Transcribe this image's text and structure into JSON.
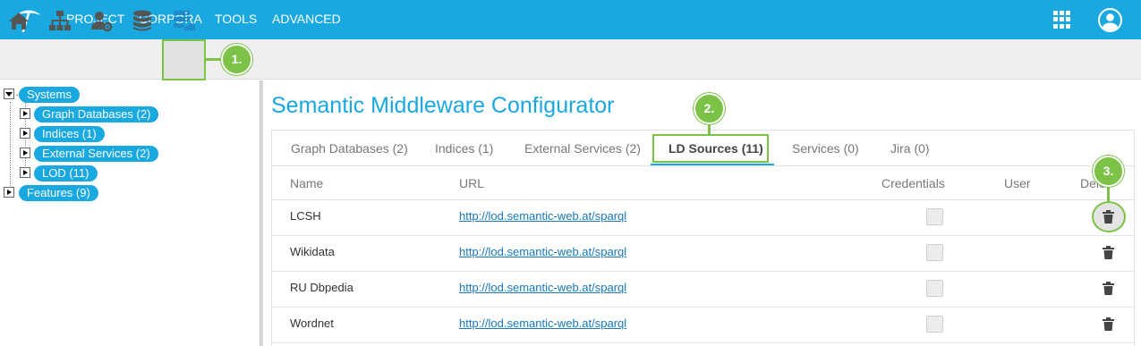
{
  "topnav": [
    "PROJECT",
    "CORPORA",
    "TOOLS",
    "ADVANCED"
  ],
  "callouts": [
    "1.",
    "2.",
    "3."
  ],
  "tree": {
    "root": "Systems",
    "children": [
      "Graph Databases (2)",
      "Indices (1)",
      "External Services (2)",
      "LOD (11)"
    ],
    "sibling": "Features (9)"
  },
  "page_title": "Semantic Middleware Configurator",
  "tabs": [
    {
      "label": "Graph Databases (2)",
      "active": false
    },
    {
      "label": "Indices (1)",
      "active": false
    },
    {
      "label": "External Services (2)",
      "active": false
    },
    {
      "label": "LD Sources (11)",
      "active": true
    },
    {
      "label": "Services (0)",
      "active": false
    },
    {
      "label": "Jira (0)",
      "active": false
    }
  ],
  "table": {
    "headers": [
      "Name",
      "URL",
      "Credentials",
      "User",
      "Dele"
    ],
    "rows": [
      {
        "name": "LCSH",
        "url": "http://lod.semantic-web.at/sparql",
        "credentials": false
      },
      {
        "name": "Wikidata",
        "url": "http://lod.semantic-web.at/sparql",
        "credentials": false
      },
      {
        "name": "RU Dbpedia",
        "url": "http://lod.semantic-web.at/sparql",
        "credentials": false
      },
      {
        "name": "Wordnet",
        "url": "http://lod.semantic-web.at/sparql",
        "credentials": false
      }
    ]
  },
  "icons": {
    "toolbar": [
      "home-icon",
      "sitemap-icon",
      "user-settings-icon",
      "database-icon",
      "server-cloud-icon"
    ],
    "row_action": "trash-icon"
  },
  "colors": {
    "brand": "#19a8e0",
    "callout": "#7cc247"
  }
}
